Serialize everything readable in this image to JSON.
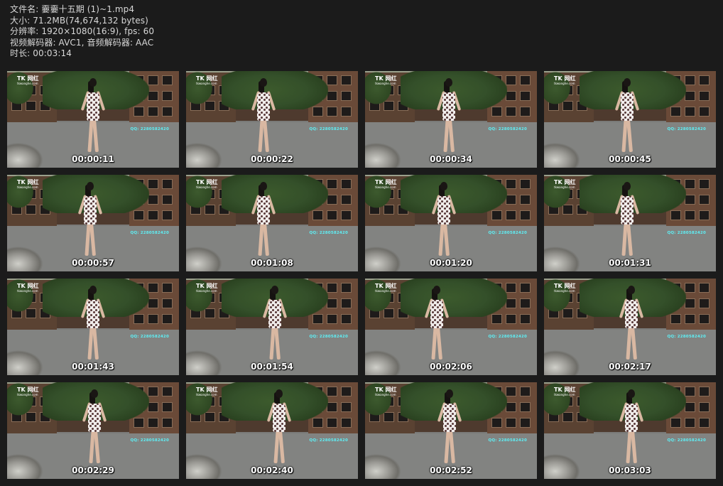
{
  "header": {
    "filename": "文件名: 嫑嫑十五期 (1)~1.mp4",
    "size": "大小: 71.2MB(74,674,132 bytes)",
    "resolution": "分辨率: 1920×1080(16:9), fps: 60",
    "codec": "视频解码器: AVC1, 音频解码器: AAC",
    "duration": "时长: 00:03:14"
  },
  "overlay": {
    "logo": "TK 网红",
    "logo_sub": "tkwanghe.com",
    "watermark": "QQ: 2280582420"
  },
  "thumbnails": [
    {
      "time": "00:00:11"
    },
    {
      "time": "00:00:22"
    },
    {
      "time": "00:00:34"
    },
    {
      "time": "00:00:45"
    },
    {
      "time": "00:00:57"
    },
    {
      "time": "00:01:08"
    },
    {
      "time": "00:01:20"
    },
    {
      "time": "00:01:31"
    },
    {
      "time": "00:01:43"
    },
    {
      "time": "00:01:54"
    },
    {
      "time": "00:02:06"
    },
    {
      "time": "00:02:17"
    },
    {
      "time": "00:02:29"
    },
    {
      "time": "00:02:40"
    },
    {
      "time": "00:02:52"
    },
    {
      "time": "00:03:03"
    }
  ]
}
